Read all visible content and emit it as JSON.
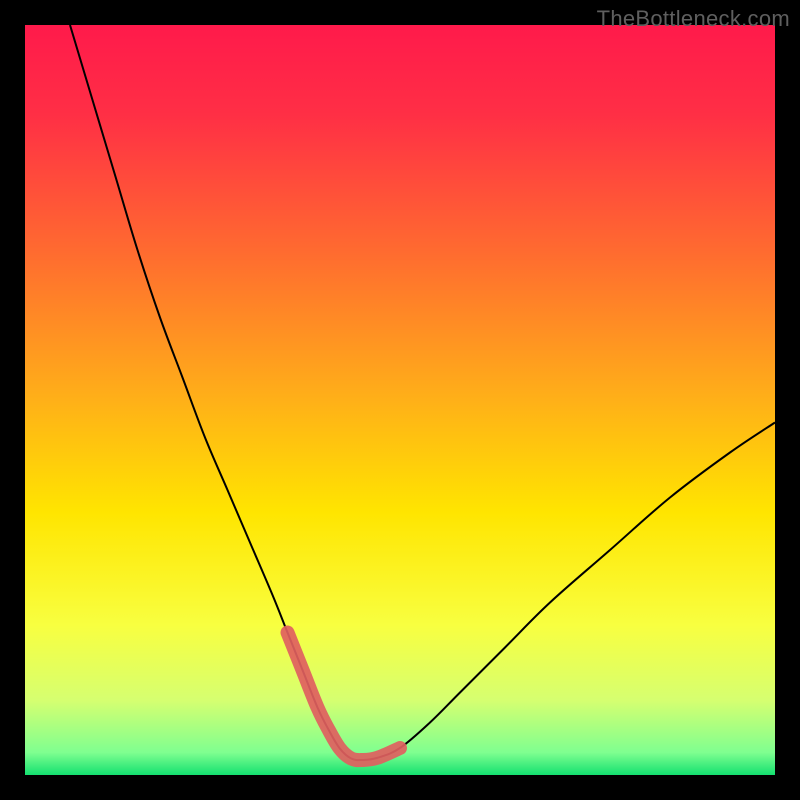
{
  "watermark": "TheBottleneck.com",
  "chart_data": {
    "type": "line",
    "title": "",
    "xlabel": "",
    "ylabel": "",
    "xlim": [
      0,
      100
    ],
    "ylim": [
      0,
      100
    ],
    "gradient_stops": [
      {
        "offset": 0.0,
        "color": "#ff1a4b"
      },
      {
        "offset": 0.12,
        "color": "#ff2f45"
      },
      {
        "offset": 0.3,
        "color": "#ff6a30"
      },
      {
        "offset": 0.5,
        "color": "#ffb018"
      },
      {
        "offset": 0.65,
        "color": "#ffe500"
      },
      {
        "offset": 0.8,
        "color": "#f8ff40"
      },
      {
        "offset": 0.9,
        "color": "#d6ff70"
      },
      {
        "offset": 0.97,
        "color": "#7fff90"
      },
      {
        "offset": 1.0,
        "color": "#14e070"
      }
    ],
    "series": [
      {
        "name": "bottleneck-curve",
        "x": [
          6,
          9,
          12,
          15,
          18,
          21,
          24,
          27,
          30,
          33,
          35,
          37,
          39,
          40.5,
          42,
          43.5,
          45,
          47,
          50,
          54,
          58,
          64,
          70,
          78,
          86,
          94,
          100
        ],
        "y": [
          100,
          90,
          80,
          70,
          61,
          53,
          45,
          38,
          31,
          24,
          19,
          14,
          9,
          6,
          3.5,
          2.2,
          2,
          2.3,
          3.6,
          7,
          11,
          17,
          23,
          30,
          37,
          43,
          47
        ]
      }
    ],
    "highlight_segment": {
      "name": "minimum-band",
      "color": "#e06060",
      "x": [
        35,
        37,
        39,
        40.5,
        42,
        43.5,
        45,
        47,
        50
      ],
      "y": [
        19,
        14,
        9,
        6,
        3.5,
        2.2,
        2,
        2.3,
        3.6
      ]
    }
  }
}
